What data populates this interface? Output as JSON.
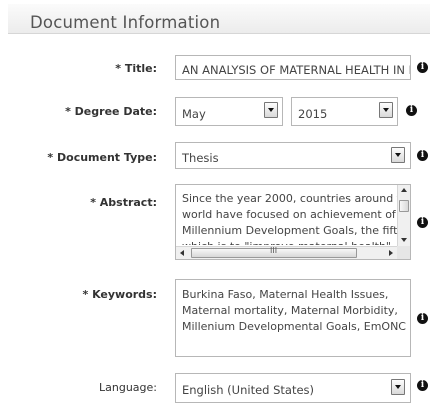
{
  "section": {
    "title": "Document Information"
  },
  "fields": {
    "title": {
      "label": "* Title:",
      "value": "AN ANALYSIS OF MATERNAL HEALTH IN BURKINA FASO"
    },
    "degree_date": {
      "label": "* Degree Date:",
      "month": "May",
      "year": "2015"
    },
    "document_type": {
      "label": "* Document Type:",
      "value": "Thesis"
    },
    "abstract": {
      "label": "* Abstract:",
      "lines": [
        "Since the year 2000, countries around the",
        "world have focused on achievement of the",
        "Millennium Development Goals, the fifth of",
        "which is to \"improve maternal health\"."
      ]
    },
    "keywords": {
      "label": "* Keywords:",
      "lines": [
        "Burkina Faso, Maternal Health Issues,",
        "Maternal mortality, Maternal Morbidity,",
        "Millenium Developmental Goals, EmONC"
      ]
    },
    "language": {
      "label": "Language:",
      "value": "English (United States)"
    }
  },
  "icons": {
    "info": "info-icon",
    "dropdown": "dropdown-arrow-icon"
  },
  "info_icon_glyph": "i",
  "hscroll_grip": "III"
}
